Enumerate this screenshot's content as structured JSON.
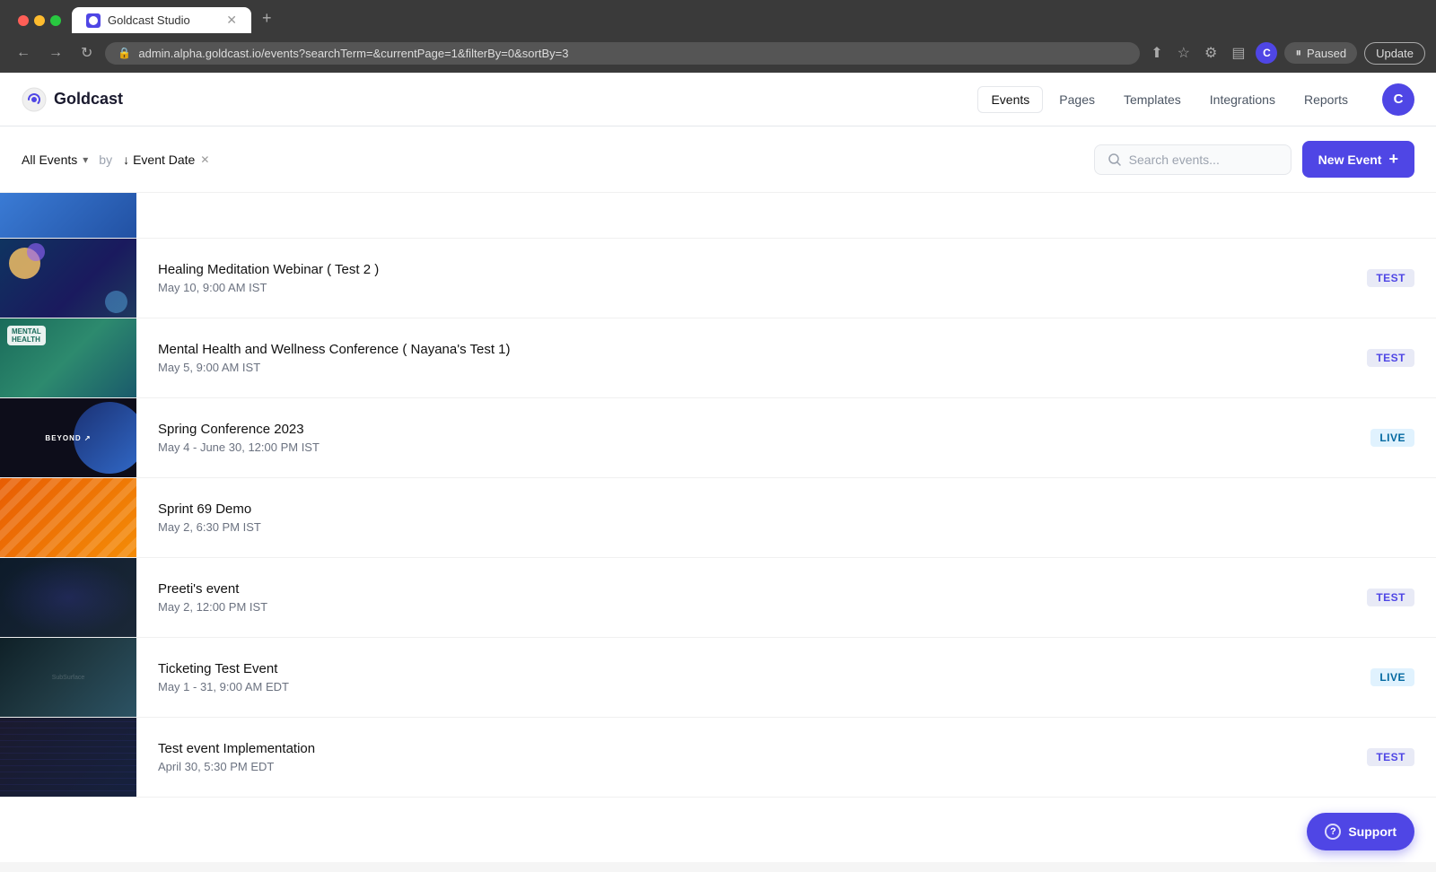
{
  "browser": {
    "tab_title": "Goldcast Studio",
    "url": "admin.alpha.goldcast.io/events?searchTerm=&currentPage=1&filterBy=0&sortBy=3",
    "paused_label": "Paused",
    "update_label": "Update",
    "profile_letter": "C"
  },
  "header": {
    "logo_text": "Goldcast",
    "nav": {
      "events_label": "Events",
      "pages_label": "Pages",
      "templates_label": "Templates",
      "integrations_label": "Integrations",
      "reports_label": "Reports"
    },
    "profile_letter": "C"
  },
  "filters": {
    "all_events_label": "All Events",
    "by_label": "by",
    "sort_label": "Event Date",
    "search_placeholder": "Search events...",
    "new_event_label": "New Event"
  },
  "events": [
    {
      "id": 1,
      "title": "Healing Meditation Webinar ( Test 2 )",
      "date": "May 10, 9:00 AM IST",
      "badge": "TEST",
      "badge_type": "test",
      "thumb_class": "thumb-2"
    },
    {
      "id": 2,
      "title": "Mental Health and Wellness Conference ( Nayana's Test 1)",
      "date": "May 5, 9:00 AM IST",
      "badge": "TEST",
      "badge_type": "test",
      "thumb_class": "thumb-3"
    },
    {
      "id": 3,
      "title": "Spring Conference 2023",
      "date": "May 4 - June 30, 12:00 PM IST",
      "badge": "LIVE",
      "badge_type": "live",
      "thumb_class": "thumb-4"
    },
    {
      "id": 4,
      "title": "Sprint 69 Demo",
      "date": "May 2, 6:30 PM IST",
      "badge": "",
      "badge_type": "none",
      "thumb_class": "thumb-5"
    },
    {
      "id": 5,
      "title": "Preeti's event",
      "date": "May 2, 12:00 PM IST",
      "badge": "TEST",
      "badge_type": "test",
      "thumb_class": "thumb-6"
    },
    {
      "id": 6,
      "title": "Ticketing Test Event",
      "date": "May 1 - 31, 9:00 AM EDT",
      "badge": "LIVE",
      "badge_type": "live",
      "thumb_class": "thumb-7"
    },
    {
      "id": 7,
      "title": "Test event Implementation",
      "date": "April 30, 5:30 PM EDT",
      "badge": "TEST",
      "badge_type": "test",
      "thumb_class": "thumb-8"
    }
  ],
  "support": {
    "label": "Support"
  }
}
